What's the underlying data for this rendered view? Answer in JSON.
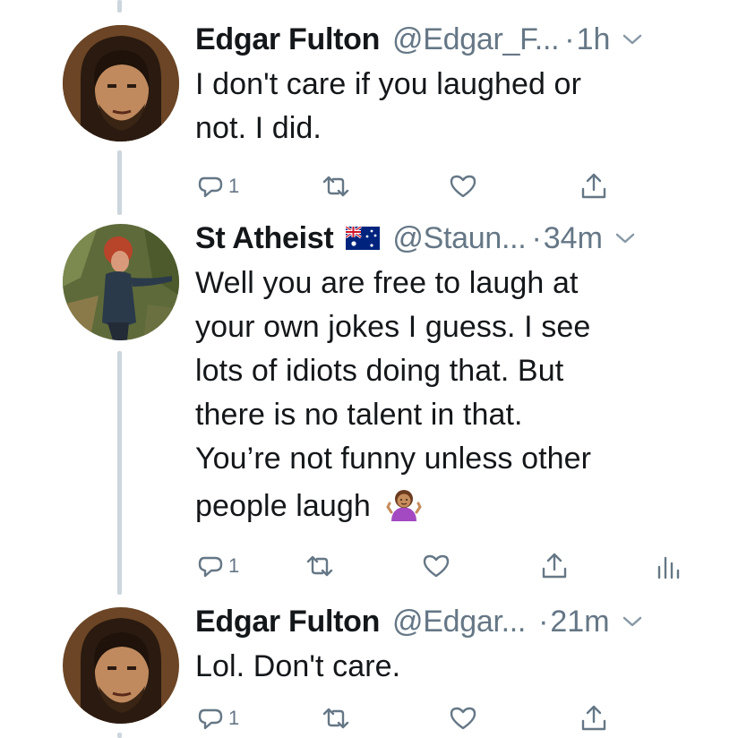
{
  "tweets": [
    {
      "name": "Edgar Fulton",
      "handle": "@Edgar_F...",
      "time": "1h",
      "lines": [
        "I don't care if you laughed or",
        "not. I did."
      ],
      "reply_count": "1"
    },
    {
      "name": "St Atheist",
      "handle": "@Staun...",
      "time": "34m",
      "lines": [
        "Well you are free to laugh at",
        "your own jokes I guess. I see",
        "lots of idiots doing that. But",
        "there is no talent in that.",
        "You’re not funny unless other",
        "people laugh"
      ],
      "emoji": "shrug-woman",
      "reply_count": "1"
    },
    {
      "name": "Edgar Fulton",
      "handle": "@Edgar...",
      "time": "21m",
      "lines": [
        "Lol. Don't care."
      ],
      "reply_count": "1"
    }
  ],
  "separator": "·",
  "colors": {
    "text": "#14171a",
    "secondary": "#657786",
    "thread_line": "#ccd6dd"
  },
  "icons": [
    "reply-icon",
    "retweet-icon",
    "like-icon",
    "share-icon",
    "analytics-icon",
    "chevron-down-icon",
    "australia-flag-icon",
    "shrug-emoji-icon"
  ]
}
